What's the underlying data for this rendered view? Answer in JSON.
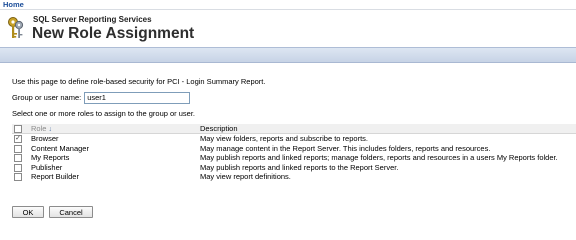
{
  "breadcrumb": {
    "home_label": "Home"
  },
  "header": {
    "app_name": "SQL Server Reporting Services",
    "page_title": "New Role Assignment"
  },
  "intro_text": "Use this page to define role-based security for PCI - Login Summary Report.",
  "user_field": {
    "label": "Group or user name:",
    "value": "user1"
  },
  "select_prompt": "Select one or more roles to assign to the group or user.",
  "table": {
    "header_role": "Role",
    "header_description": "Description",
    "rows": [
      {
        "role": "Browser",
        "description": "May view folders, reports and subscribe to reports.",
        "checked": true
      },
      {
        "role": "Content Manager",
        "description": "May manage content in the Report Server.  This includes folders, reports and resources.",
        "checked": false
      },
      {
        "role": "My Reports",
        "description": "May publish reports and linked reports; manage folders, reports and resources in a users My Reports folder.",
        "checked": false
      },
      {
        "role": "Publisher",
        "description": "May publish reports and linked reports to the Report Server.",
        "checked": false
      },
      {
        "role": "Report Builder",
        "description": "May view report definitions.",
        "checked": false
      }
    ]
  },
  "buttons": {
    "ok_label": "OK",
    "cancel_label": "Cancel"
  },
  "icons": {
    "logo": "keys-icon",
    "sort": "sort-down-icon"
  },
  "colors": {
    "link": "#1c4e9a",
    "band": "#cfdaeb"
  }
}
